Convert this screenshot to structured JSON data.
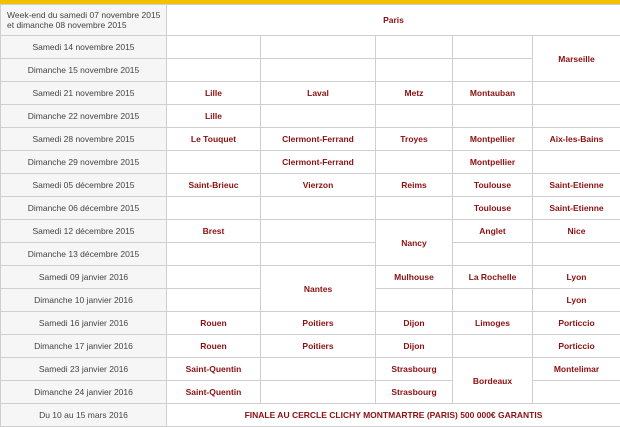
{
  "header": {
    "weekend_line1": "Week-end du samedi 07 novembre 2015",
    "weekend_line2": "et dimanche 08 novembre 2015",
    "paris": "Paris"
  },
  "rows": [
    {
      "date": "Samedi 14 novembre 2015"
    },
    {
      "date": "Dimanche 15 novembre 2015"
    },
    {
      "date": "Samedi 21 novembre 2015"
    },
    {
      "date": "Dimanche 22 novembre 2015"
    },
    {
      "date": "Samedi 28 novembre 2015"
    },
    {
      "date": "Dimanche 29 novembre 2015"
    },
    {
      "date": "Samedi 05 décembre 2015"
    },
    {
      "date": "Dimanche 06 décembre 2015"
    },
    {
      "date": "Samedi 12 décembre 2015"
    },
    {
      "date": "Dimanche 13 décembre 2015"
    },
    {
      "date": "Samedi 09 janvier 2016"
    },
    {
      "date": "Dimanche 10 janvier 2016"
    },
    {
      "date": "Samedi 16 janvier 2016"
    },
    {
      "date": "Dimanche 17 janvier 2016"
    },
    {
      "date": "Samedi 23 janvier 2016"
    },
    {
      "date": "Dimanche 24 janvier 2016"
    },
    {
      "date": "Du 10 au 15 mars 2016"
    }
  ],
  "cities": {
    "marseille": "Marseille",
    "lille_21": "Lille",
    "laval": "Laval",
    "metz": "Metz",
    "montauban": "Montauban",
    "lille_22": "Lille",
    "le_touquet": "Le Touquet",
    "clermont_28": "Clermont-Ferrand",
    "troyes": "Troyes",
    "montpellier_28": "Montpellier",
    "aix": "Aix-les-Bains",
    "clermont_29": "Clermont-Ferrand",
    "montpellier_29": "Montpellier",
    "saint_brieuc": "Saint-Brieuc",
    "vierzon": "Vierzon",
    "reims": "Reims",
    "toulouse_05": "Toulouse",
    "saint_etienne_05": "Saint-Etienne",
    "toulouse_06": "Toulouse",
    "saint_etienne_06": "Saint-Etienne",
    "brest": "Brest",
    "nancy": "Nancy",
    "anglet": "Anglet",
    "nice": "Nice",
    "nantes": "Nantes",
    "mulhouse": "Mulhouse",
    "la_rochelle": "La Rochelle",
    "lyon_09": "Lyon",
    "lyon_10": "Lyon",
    "rouen_16": "Rouen",
    "poitiers_16": "Poitiers",
    "dijon_16": "Dijon",
    "limoges": "Limoges",
    "porticcio_16": "Porticcio",
    "rouen_17": "Rouen",
    "poitiers_17": "Poitiers",
    "dijon_17": "Dijon",
    "porticcio_17": "Porticcio",
    "saint_quentin_23": "Saint-Quentin",
    "strasbourg_23": "Strasbourg",
    "bordeaux": "Bordeaux",
    "montelimar": "Montelimar",
    "saint_quentin_24": "Saint-Quentin",
    "strasbourg_24": "Strasbourg"
  },
  "finale": "FINALE AU CERCLE CLICHY MONTMARTRE (PARIS) 500 000€ GARANTIS"
}
